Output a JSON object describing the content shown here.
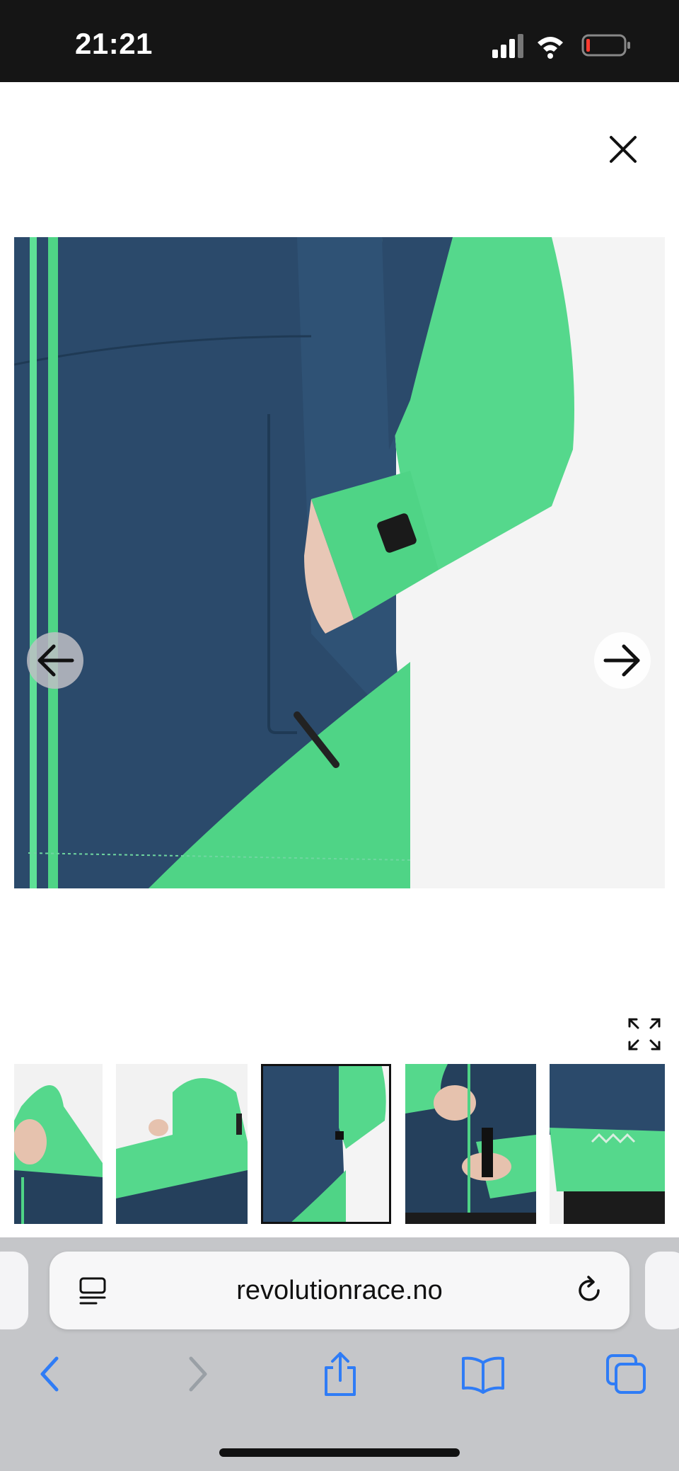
{
  "status_bar": {
    "time": "21:21"
  },
  "gallery": {
    "thumbnails": [
      {
        "name": "hood-front"
      },
      {
        "name": "hood-back"
      },
      {
        "name": "pocket-detail"
      },
      {
        "name": "cuff-detail"
      },
      {
        "name": "hem-detail"
      }
    ],
    "selected_index": 2
  },
  "browser": {
    "url": "revolutionrace.no"
  },
  "colors": {
    "navy": "#2b4a6b",
    "green": "#4fd486",
    "ios_blue": "#2f7cf6"
  }
}
